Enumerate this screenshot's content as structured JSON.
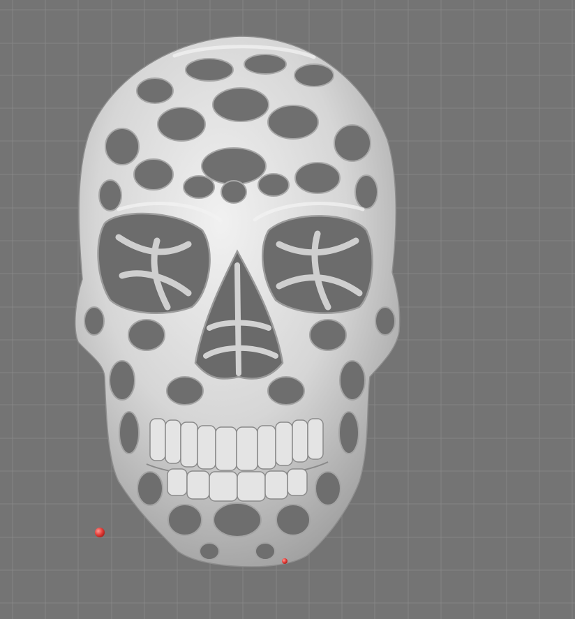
{
  "viewport": {
    "title": "",
    "background_color": "#747474",
    "grid_color": "#858585",
    "model_color": "#d9d9d9",
    "model_name": "voronoi-skull-mesh",
    "marker_color": "#e23b36",
    "markers": [
      {
        "name": "point-marker-left"
      },
      {
        "name": "point-marker-chin"
      }
    ]
  }
}
